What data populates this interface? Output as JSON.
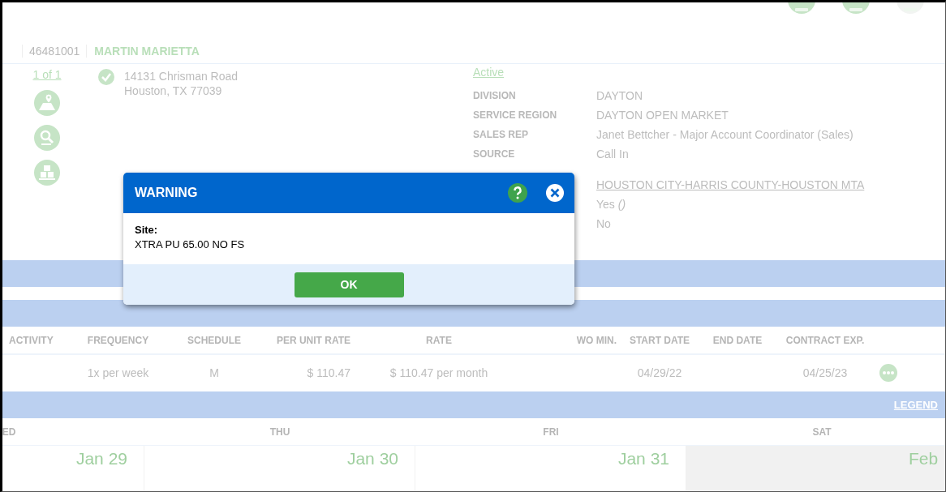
{
  "account": {
    "number": "46481001",
    "name": "MARTIN MARIETTA"
  },
  "site": {
    "pager": "1 of 1",
    "verified": true,
    "address": [
      "14131 Chrisman Road",
      "Houston, TX 77039"
    ]
  },
  "status": "Active",
  "details": [
    {
      "label": "DIVISION",
      "value": "DAYTON",
      "link": false
    },
    {
      "label": "SERVICE REGION",
      "value": "DAYTON OPEN MARKET",
      "link": false
    },
    {
      "label": "SALES REP",
      "value": "Janet Bettcher - Major Account Coordinator (Sales)",
      "link": false
    },
    {
      "label": "SOURCE",
      "value": "Call In",
      "link": false
    },
    {
      "value": "HOUSTON CITY-HARRIS COUNTY-HOUSTON MTA",
      "link": true
    },
    {
      "value": "Yes *()*",
      "link": false
    },
    {
      "value": "No",
      "link": false
    }
  ],
  "table": {
    "columns": [
      "ACTIVITY",
      "FREQUENCY",
      "SCHEDULE",
      "PER UNIT RATE",
      "RATE",
      "WO MIN.",
      "START DATE",
      "END DATE",
      "CONTRACT EXP."
    ],
    "rows": [
      {
        "cells": [
          null,
          "1x per week",
          "M",
          "$ 110.47",
          "$ 110.47 per month",
          null,
          "04/29/22",
          null,
          "04/25/23"
        ]
      }
    ]
  },
  "legend": "LEGEND",
  "calendar": {
    "days": [
      {
        "label": "ED",
        "date": "Jan 29",
        "weekend": false
      },
      {
        "label": "THU",
        "date": "Jan 30",
        "weekend": false
      },
      {
        "label": "FRI",
        "date": "Jan 31",
        "weekend": false
      },
      {
        "label": "SAT",
        "date": "Feb",
        "weekend": true
      }
    ]
  },
  "dialog": {
    "title": "WARNING",
    "label": "Site:",
    "message": "XTRA PU 65.00 NO FS",
    "button": "OK"
  }
}
